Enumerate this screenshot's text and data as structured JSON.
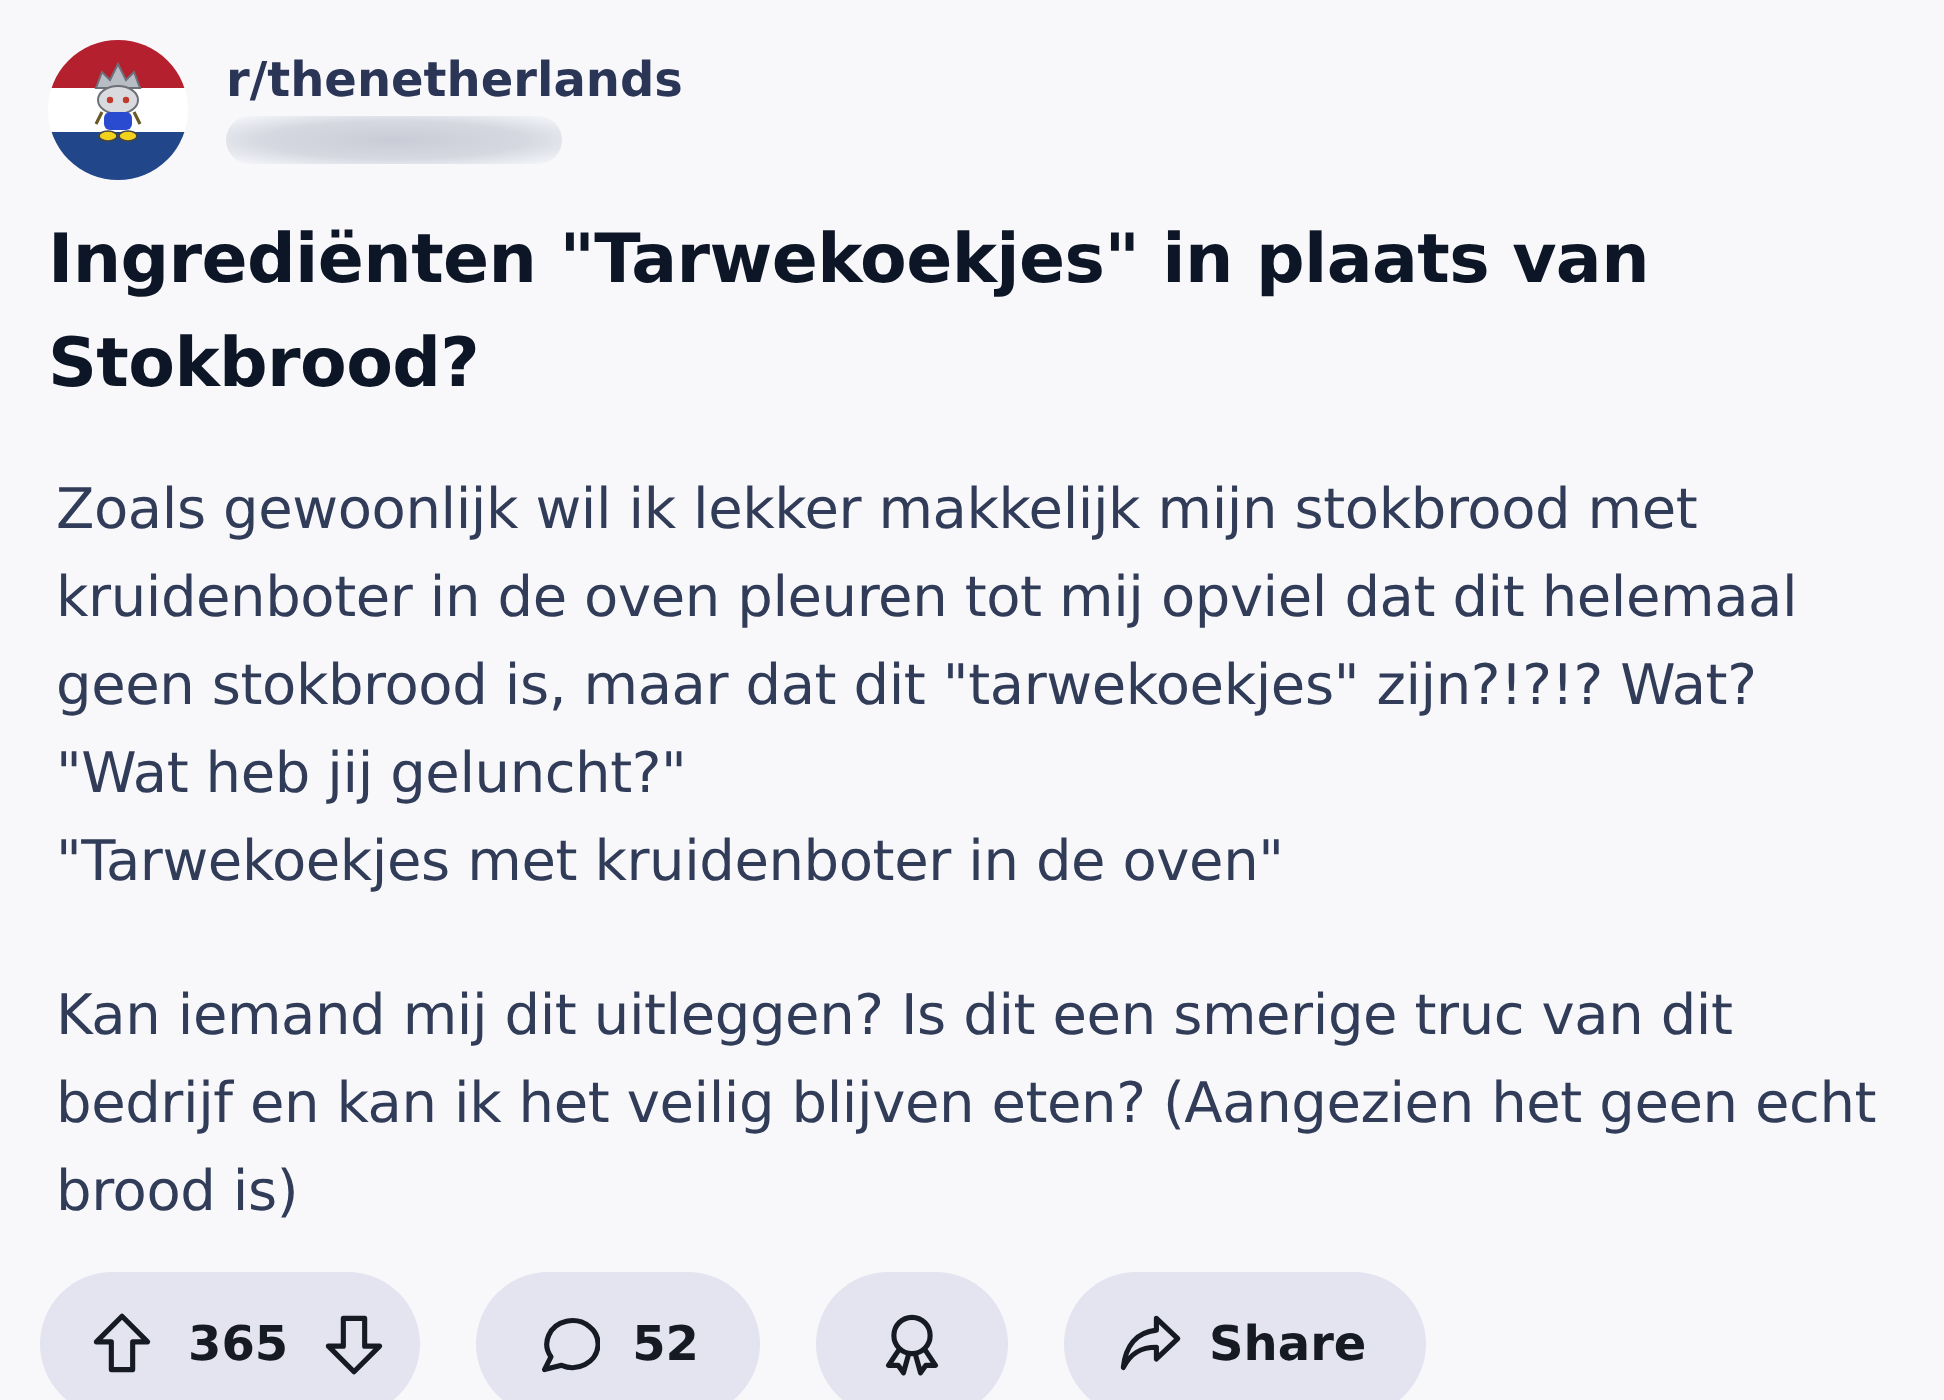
{
  "post": {
    "subreddit": "r/thenetherlands",
    "title": "Ingrediënten \"Tarwekoekjes\" in plaats van Stokbrood?",
    "body": [
      "Zoals gewoonlijk wil ik lekker makkelijk mijn stokbrood met kruidenboter in de oven pleuren tot mij opviel dat dit helemaal geen stokbrood is, maar dat dit \"tarwekoekjes\" zijn?!?!? Wat?\n\"Wat heb jij geluncht?\"\n\"Tarwekoekjes met kruidenboter in de oven\"",
      "Kan iemand mij dit uitleggen? Is dit een smerige truc van dit bedrijf en kan ik het veilig blijven eten? (Aangezien het geen echt brood is)"
    ]
  },
  "actions": {
    "score": "365",
    "comments": "52",
    "share": "Share"
  }
}
